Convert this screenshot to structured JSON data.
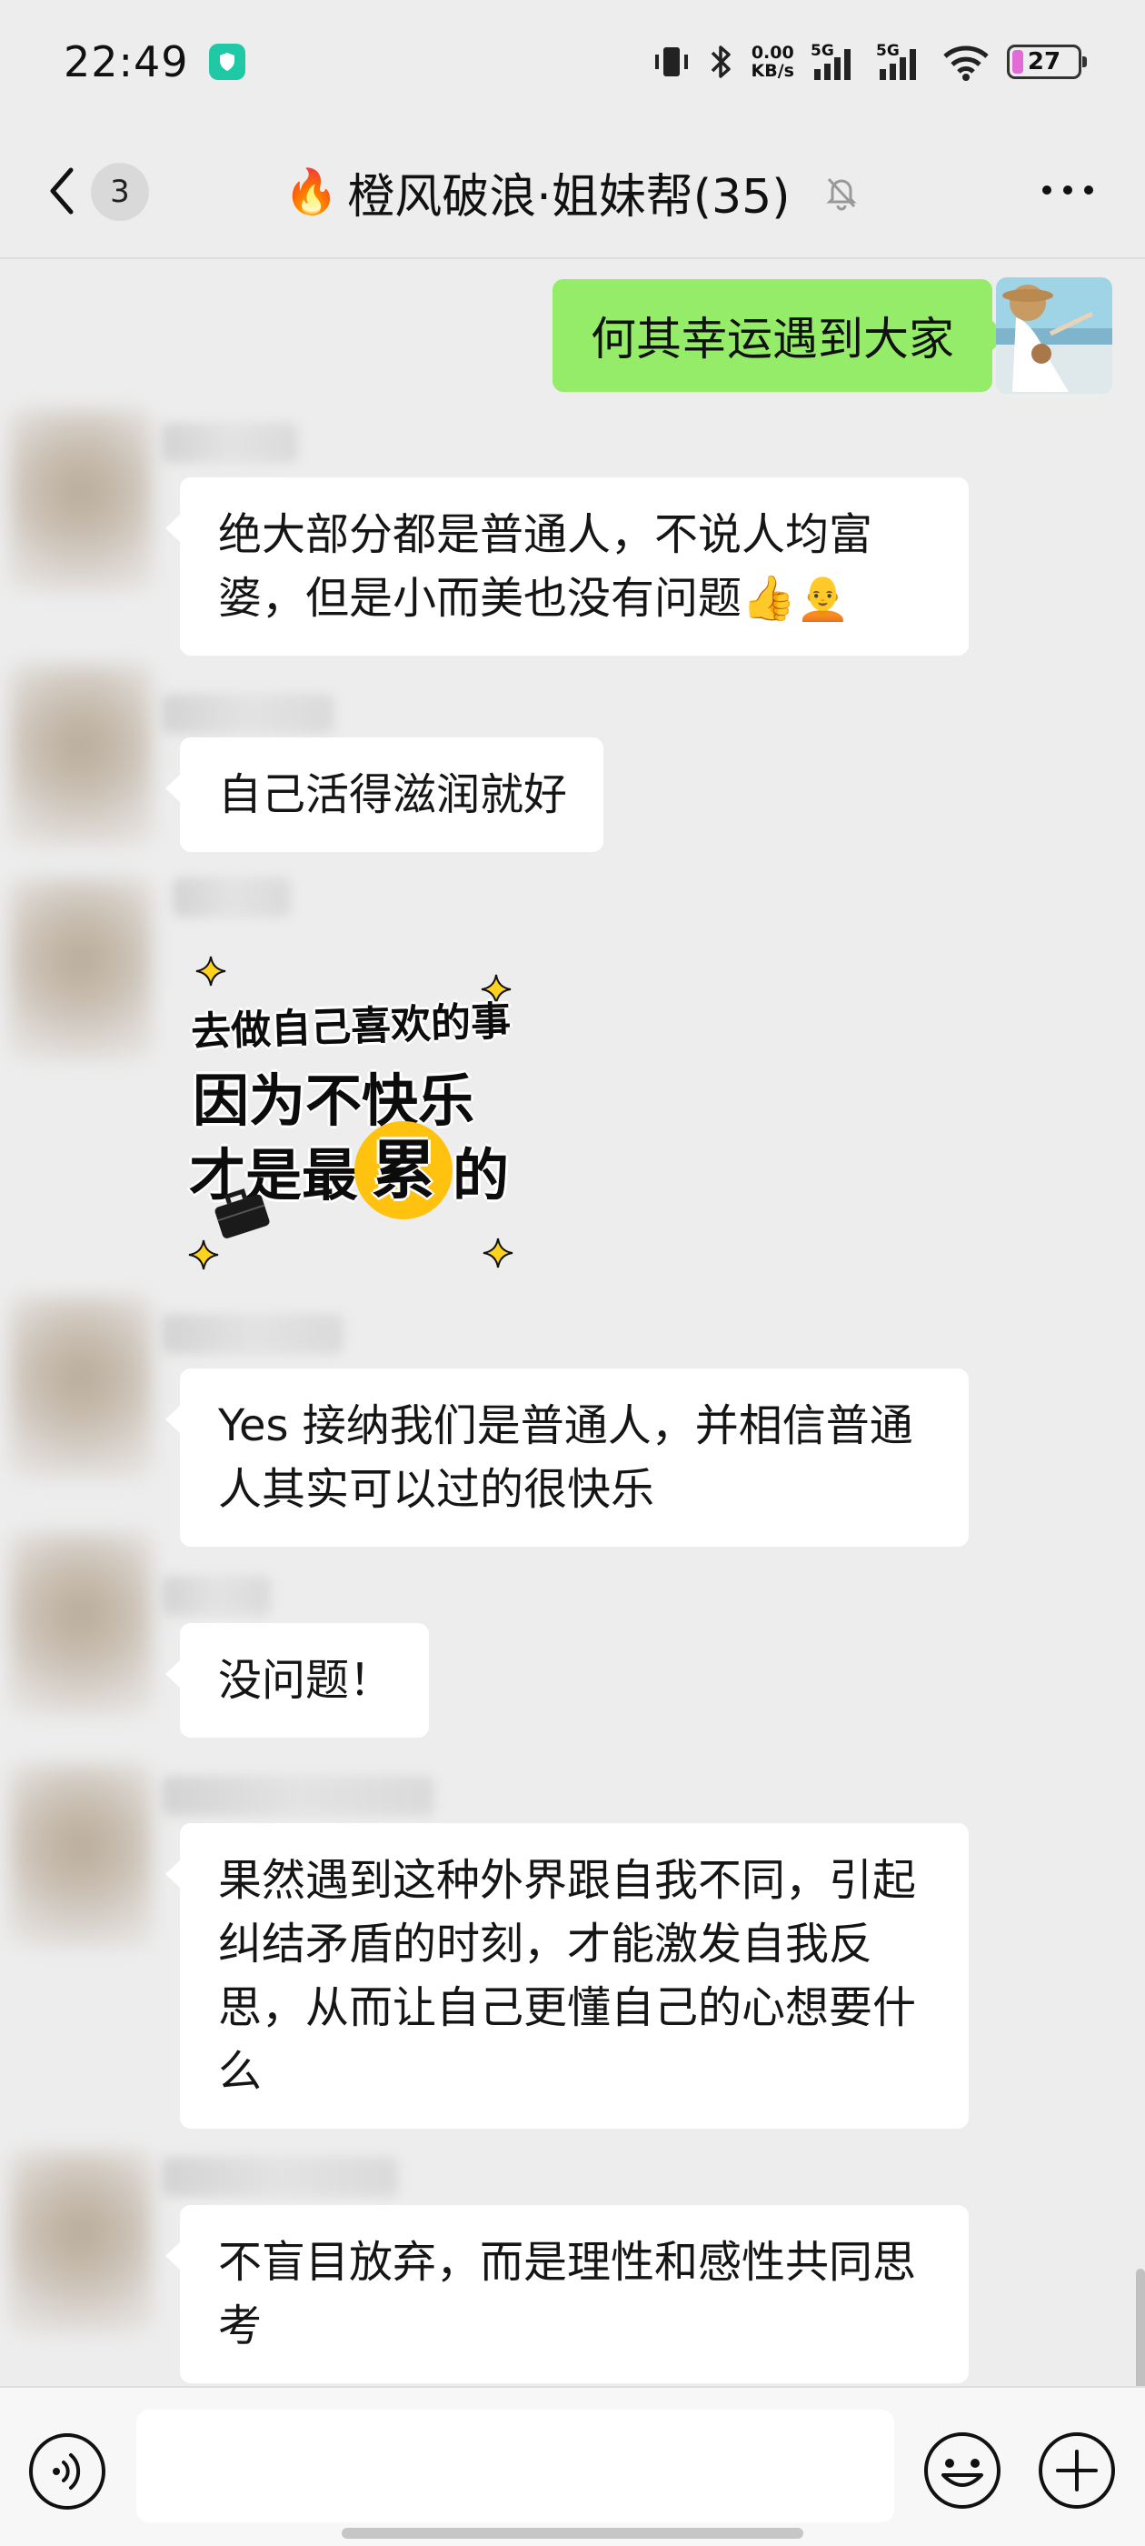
{
  "status_bar": {
    "time": "22:49",
    "net_speed_value": "0.00",
    "net_speed_unit": "KB/s",
    "signal1_label": "5G",
    "signal2_label": "5G",
    "battery": "27"
  },
  "nav": {
    "unread_count": "3",
    "title_emoji": "🔥",
    "title": "橙风破浪·姐妹帮(35)"
  },
  "messages": [
    {
      "sender": "me",
      "text": "何其幸运遇到大家"
    },
    {
      "sender": "other",
      "text": "绝大部分都是普通人，不说人均富婆，但是小而美也没有问题👍🧑‍🦲"
    },
    {
      "sender": "other",
      "text": "自己活得滋润就好"
    },
    {
      "sender": "other",
      "type": "sticker",
      "lines": [
        "去做自己喜欢的事",
        "因为不快乐",
        "才是最",
        "累",
        "的"
      ]
    },
    {
      "sender": "other",
      "text": "Yes 接纳我们是普通人，并相信普通人其实可以过的很快乐"
    },
    {
      "sender": "other",
      "text": "没问题！"
    },
    {
      "sender": "other",
      "text": "果然遇到这种外界跟自我不同，引起纠结矛盾的时刻，才能激发自我反思，从而让自己更懂自己的心想要什么"
    },
    {
      "sender": "other",
      "text": "不盲目放弃，而是理性和感性共同思考"
    }
  ],
  "colors": {
    "background": "#ededed",
    "my_bubble": "#95ec69",
    "other_bubble": "#ffffff",
    "sticker_highlight": "#ffc20e"
  },
  "icons": {
    "back": "chevron-left-icon",
    "mute": "bell-off-icon",
    "more": "more-dots-icon",
    "voice": "voice-icon",
    "emoji": "emoji-icon",
    "plus": "plus-icon"
  }
}
